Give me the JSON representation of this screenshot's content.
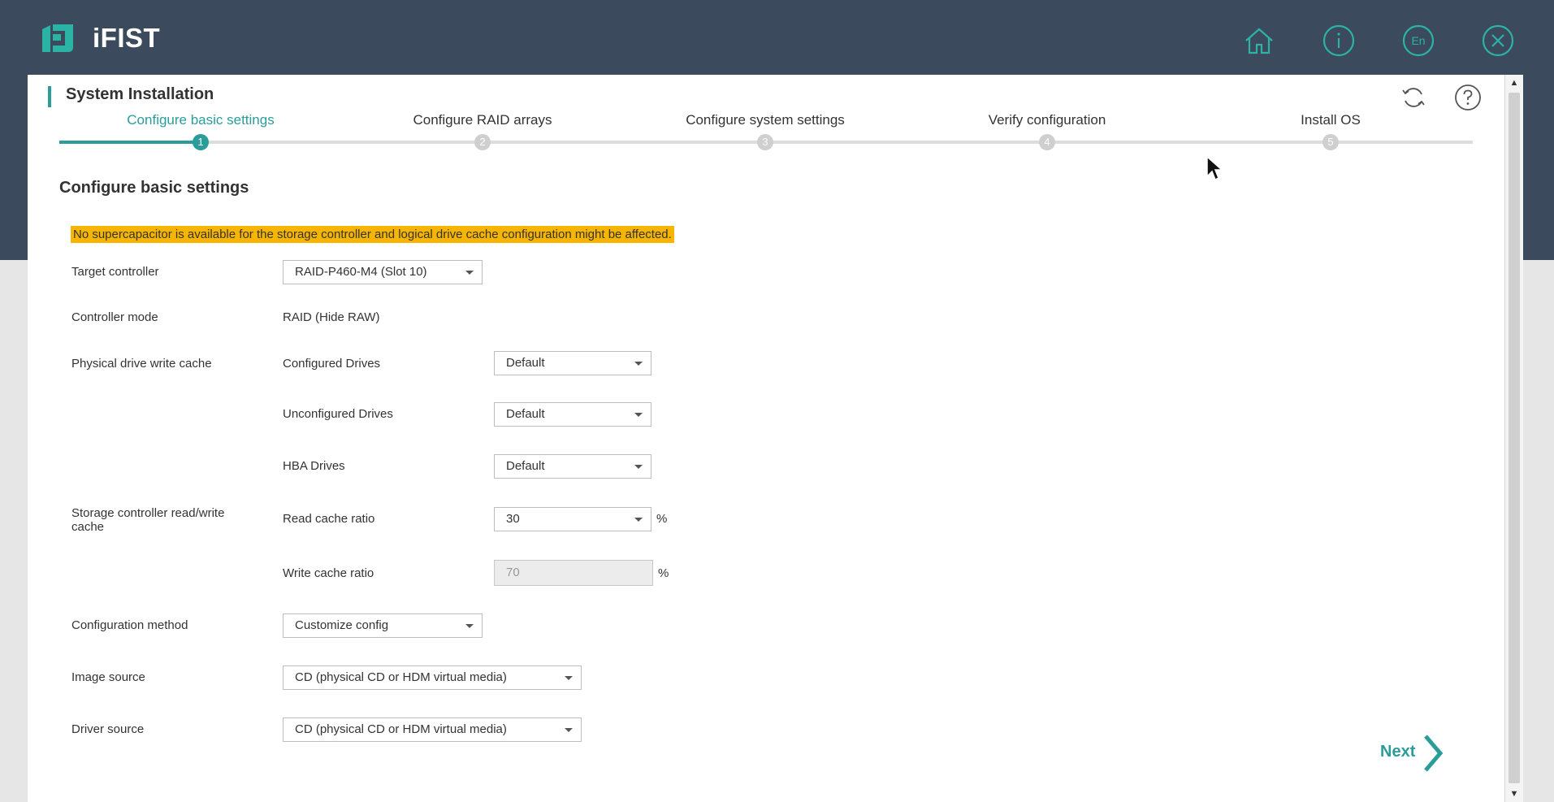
{
  "app": {
    "name": "iFIST"
  },
  "header_icons": [
    "home-icon",
    "info-icon",
    "language-icon",
    "close-icon"
  ],
  "panel": {
    "title": "System Installation",
    "icons": [
      "refresh-icon",
      "help-icon"
    ]
  },
  "steps": [
    {
      "label": "Configure basic settings",
      "number": "1",
      "active": true
    },
    {
      "label": "Configure RAID arrays",
      "number": "2",
      "active": false
    },
    {
      "label": "Configure system settings",
      "number": "3",
      "active": false
    },
    {
      "label": "Verify configuration",
      "number": "4",
      "active": false
    },
    {
      "label": "Install OS",
      "number": "5",
      "active": false
    }
  ],
  "section_title": "Configure basic settings",
  "warning": "No supercapacitor is available for the storage controller and logical drive cache configuration might be affected.",
  "form": {
    "target_controller": {
      "label": "Target controller",
      "value": "RAID-P460-M4 (Slot 10)"
    },
    "controller_mode": {
      "label": "Controller mode",
      "value": "RAID (Hide RAW)"
    },
    "pd_write_cache": {
      "label": "Physical drive write cache",
      "configured": {
        "label": "Configured Drives",
        "value": "Default"
      },
      "unconfigured": {
        "label": "Unconfigured Drives",
        "value": "Default"
      },
      "hba": {
        "label": "HBA Drives",
        "value": "Default"
      }
    },
    "rw_cache": {
      "label": "Storage controller read/write cache",
      "read": {
        "label": "Read cache ratio",
        "value": "30",
        "unit": "%"
      },
      "write": {
        "label": "Write cache ratio",
        "value": "70",
        "unit": "%"
      }
    },
    "config_method": {
      "label": "Configuration method",
      "value": "Customize config"
    },
    "image_source": {
      "label": "Image source",
      "value": "CD (physical CD or HDM virtual media)"
    },
    "driver_source": {
      "label": "Driver source",
      "value": "CD (physical CD or HDM virtual media)"
    }
  },
  "next_label": "Next",
  "colors": {
    "accent": "#2a9d9a",
    "header_bg": "#3c4a5e",
    "warning_bg": "#f7b500"
  }
}
